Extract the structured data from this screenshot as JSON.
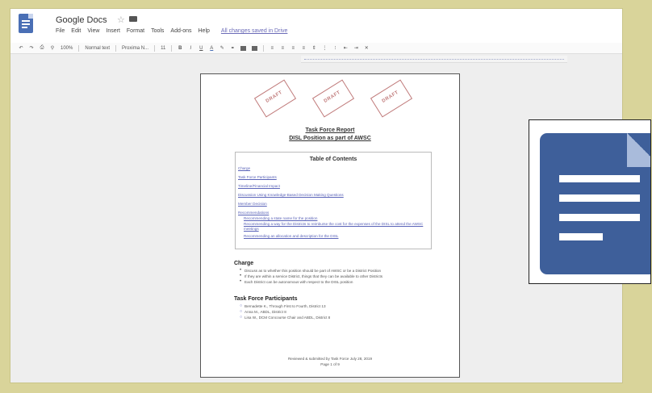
{
  "app": {
    "title": "Google Docs",
    "menu": [
      "File",
      "Edit",
      "View",
      "Insert",
      "Format",
      "Tools",
      "Add-ons",
      "Help"
    ],
    "saved_status": "All changes saved in Drive"
  },
  "toolbar": {
    "zoom": "100%",
    "style": "Normal text",
    "font": "Proxima N...",
    "font_size": "11",
    "bold": "B",
    "italic": "I",
    "underline": "U",
    "text_color": "A"
  },
  "document": {
    "stamp_text": "DRAFT",
    "heading_line1": "Task Force Report",
    "heading_line2": "DISL Position as part of AWSC",
    "toc_title": "Table of Contents",
    "toc_items": [
      "Charge",
      "Task Force Participants",
      "Timeline/Financial Impact",
      "Discussion Using Knowledge-Based Decision Making Questions",
      "Member Decision",
      "Recommendations",
      "Recommending a state name for the position",
      "Recommending a way for the Districts to reimburse the cost for the expenses of the DISL to attend the AWSC meetings",
      "Recommending an allocation and description for the DISL"
    ],
    "charge": {
      "title": "Charge",
      "bullets": [
        "Discuss as to whether this position should be part of AWSC or be a District Position",
        "If they are within a service District, things that they can be available to other Districts",
        "Each District can be autonomous with respect to the DISL position"
      ]
    },
    "participants": {
      "title": "Task Force Participants",
      "items": [
        "Bernadette K., Through First to Fourth, District 13",
        "Anna M., ABDL, District 8",
        "Lisa W., DCM Concourse Chair and ABDL, District 8"
      ]
    },
    "footer_line1": "Reviewed & submitted by Task Force July 28, 2019",
    "footer_line2": "Page 1 of 9"
  },
  "colors": {
    "background": "#d9d49a",
    "docs_blue": "#3e5f9a",
    "link": "#5a63b8",
    "stamp": "#c07a7a"
  }
}
